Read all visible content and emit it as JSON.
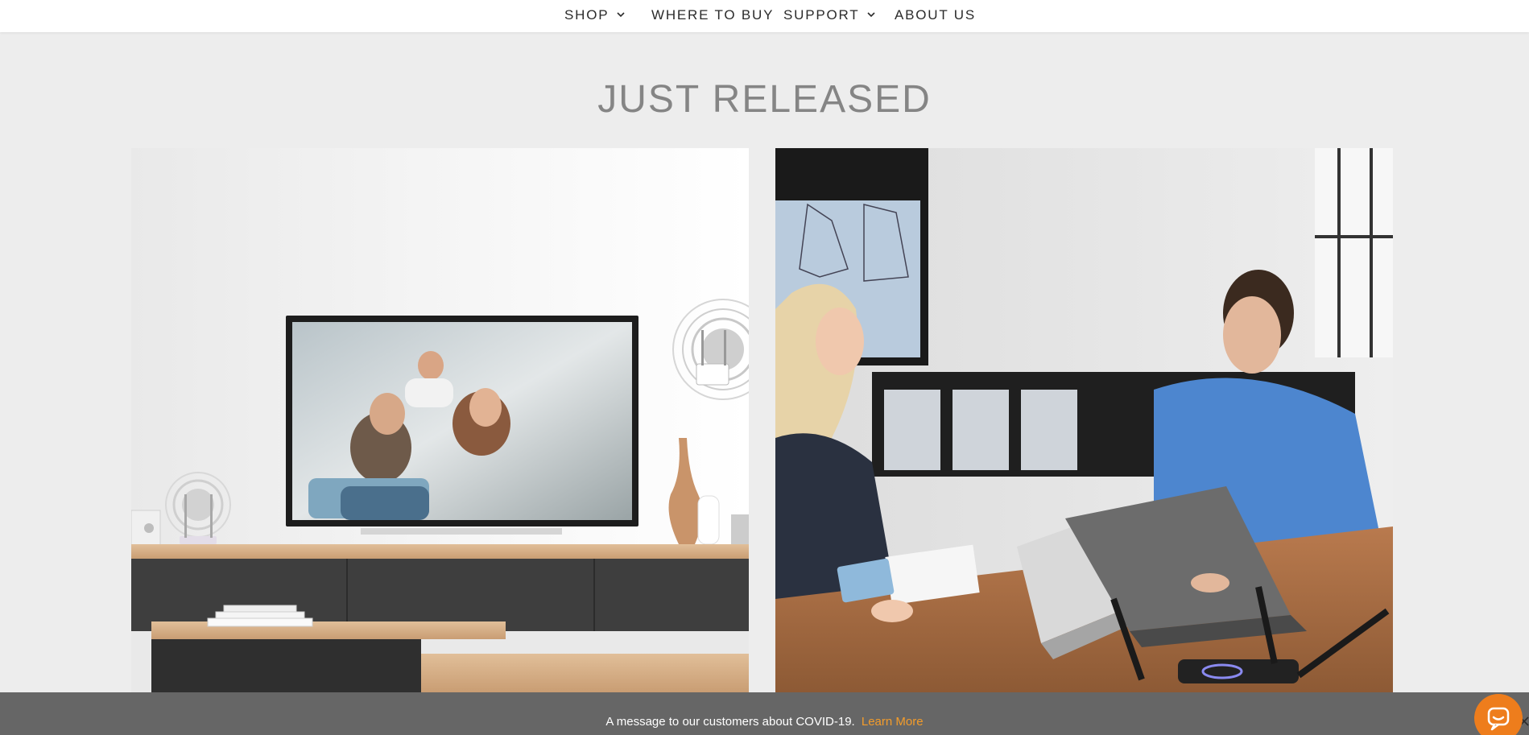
{
  "nav": {
    "items": [
      {
        "label": "SHOP",
        "has_dropdown": true
      },
      {
        "label": "WHERE TO BUY",
        "has_dropdown": false
      },
      {
        "label": "SUPPORT",
        "has_dropdown": true
      },
      {
        "label": "ABOUT US",
        "has_dropdown": false
      }
    ]
  },
  "section": {
    "title": "JUST RELEASED"
  },
  "promos": [
    {
      "image": "living-room-tv-family-wifi-extender-photo"
    },
    {
      "image": "office-people-laptops-router-photo"
    }
  ],
  "banner": {
    "message": "A message to our customers about COVID-19.",
    "link_label": "Learn More"
  },
  "icons": {
    "chevron": "chevron-down-icon",
    "chat": "chat-bubble-icon",
    "close": "close-icon"
  },
  "colors": {
    "accent": "#ee7d1c",
    "link": "#f39c2b",
    "banner_bg": "#666666",
    "title": "#858585",
    "page_bg": "#ededed"
  }
}
